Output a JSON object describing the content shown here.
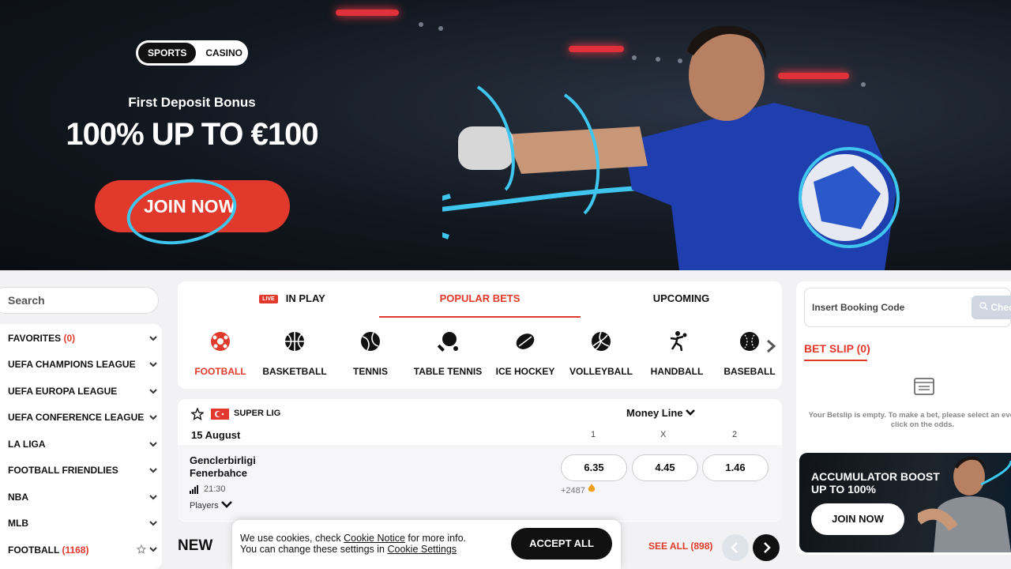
{
  "hero": {
    "toggle": {
      "sports": "SPORTS",
      "casino": "CASINO"
    },
    "subtitle": "First Deposit Bonus",
    "title": "100% UP TO €100",
    "cta": "JOIN NOW",
    "colors": {
      "cta": "#e1392b",
      "scribble": "#3fc6ef"
    }
  },
  "sidebar": {
    "search_placeholder": "Search",
    "leagues": [
      {
        "label": "FAVORITES",
        "count": "(0)"
      },
      {
        "label": "UEFA CHAMPIONS LEAGUE",
        "count": ""
      },
      {
        "label": "UEFA EUROPA LEAGUE",
        "count": ""
      },
      {
        "label": "UEFA CONFERENCE LEAGUE",
        "count": ""
      },
      {
        "label": "LA LIGA",
        "count": ""
      },
      {
        "label": "FOOTBALL FRIENDLIES",
        "count": ""
      },
      {
        "label": "NBA",
        "count": ""
      },
      {
        "label": "MLB",
        "count": ""
      },
      {
        "label": "FOOTBALL",
        "count": "(1168)"
      }
    ]
  },
  "tabs": {
    "live_badge": "LIVE",
    "in_play": "IN PLAY",
    "popular": "POPULAR BETS",
    "upcoming": "UPCOMING"
  },
  "sports": [
    {
      "label": "FOOTBALL",
      "icon": "football-icon"
    },
    {
      "label": "BASKETBALL",
      "icon": "basketball-icon"
    },
    {
      "label": "TENNIS",
      "icon": "tennis-icon"
    },
    {
      "label": "TABLE TENNIS",
      "icon": "table-tennis-icon"
    },
    {
      "label": "ICE HOCKEY",
      "icon": "ice-hockey-icon"
    },
    {
      "label": "VOLLEYBALL",
      "icon": "volleyball-icon"
    },
    {
      "label": "HANDBALL",
      "icon": "handball-icon"
    },
    {
      "label": "BASEBALL",
      "icon": "baseball-icon"
    }
  ],
  "match": {
    "league": "SUPER LIG",
    "market": "Money Line",
    "date": "15 August",
    "col1": "1",
    "colx": "X",
    "col2": "2",
    "home": "Genclerbirligi",
    "away": "Fenerbahce",
    "time": "21:30",
    "players": "Players",
    "more": "+2487",
    "odds": [
      "6.35",
      "4.45",
      "1.46"
    ]
  },
  "new_section": {
    "title": "NEW",
    "see_all": "SEE ALL (898)"
  },
  "cookie": {
    "line1_pre": "We use cookies, check ",
    "line1_link": "Cookie Notice",
    "line1_post": " for more info.",
    "line2_pre": "You can change these settings in ",
    "line2_link": "Cookie Settings",
    "accept": "ACCEPT ALL"
  },
  "betslip": {
    "booking_placeholder": "Insert Booking Code",
    "check": "Check",
    "title": "BET SLIP (0)",
    "empty": "Your Betslip is empty. To make a bet, please select an event and click on the odds."
  },
  "promo": {
    "title_line1": "ACCUMULATOR BOOST",
    "title_line2": "UP TO 100%",
    "cta": "JOIN NOW"
  }
}
